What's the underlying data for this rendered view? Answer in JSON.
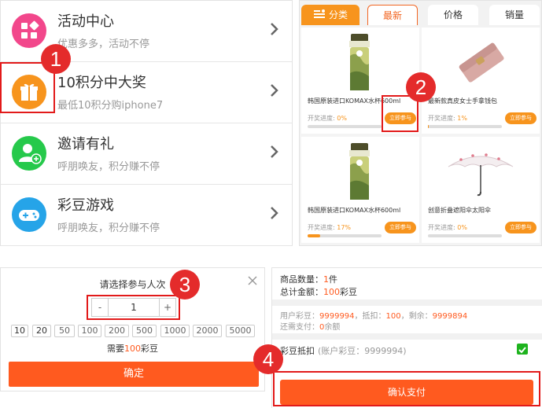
{
  "menu": {
    "items": [
      {
        "title": "活动中心",
        "subtitle": "优惠多多，活动不停",
        "icon": "grid-icon",
        "color": "#f2478b"
      },
      {
        "title": "10积分中大奖",
        "subtitle": "最低10积分购iphone7",
        "icon": "gift-icon",
        "color": "#f7941d"
      },
      {
        "title": "邀请有礼",
        "subtitle": "呼朋唤友，积分赚不停",
        "icon": "add-user-icon",
        "color": "#26c94b"
      },
      {
        "title": "彩豆游戏",
        "subtitle": "呼朋唤友，积分赚不停",
        "icon": "gamepad-icon",
        "color": "#26a4e8"
      }
    ]
  },
  "products": {
    "tabs": [
      "分类",
      "最新",
      "价格",
      "销量"
    ],
    "active_tab": "最新",
    "progress_label": "开奖进度:",
    "join_label": "立即参与",
    "items": [
      {
        "name": "韩国原装进口KOMAX水杯600ml",
        "progress_text": "0%",
        "progress": 0
      },
      {
        "name": "最新款真皮女士手拿钱包",
        "progress_text": "1%",
        "progress": 0.01
      },
      {
        "name": "韩国原装进口KOMAX水杯600ml",
        "progress_text": "17%",
        "progress": 0.17
      },
      {
        "name": "创意折叠遮阳伞太阳伞",
        "progress_text": "0%",
        "progress": 0
      }
    ]
  },
  "participants": {
    "title": "请选择参与人次",
    "minus": "-",
    "plus": "+",
    "count": "1",
    "options": [
      "10",
      "20",
      "50",
      "100",
      "200",
      "500",
      "1000",
      "2000",
      "5000"
    ],
    "need_prefix": "需要",
    "need_amount": "100",
    "need_suffix": "彩豆",
    "confirm_label": "确定"
  },
  "payment": {
    "qty_label": "商品数量：",
    "qty_value": "1",
    "qty_unit": "件",
    "total_label": "总计金额：",
    "total_value": "100",
    "total_unit": "彩豆",
    "user_beans_label": "用户彩豆：",
    "user_beans": "9999994",
    "deduct_label": "，抵扣：",
    "deduct": "100",
    "remain_label": "，剩余：",
    "remain": "9999894",
    "still_pay_label": "还需支付：",
    "still_pay_value": "0",
    "still_pay_unit": "余额",
    "deduction_title": "彩豆抵扣",
    "deduction_account": "(账户彩豆：9999994)",
    "deduction_checked": true,
    "pay_label": "确认支付"
  },
  "annotations": [
    "1",
    "2",
    "3",
    "4"
  ],
  "colors": {
    "accent": "#ff5a1f",
    "orange": "#f7941d",
    "marker": "#e42b2b"
  }
}
